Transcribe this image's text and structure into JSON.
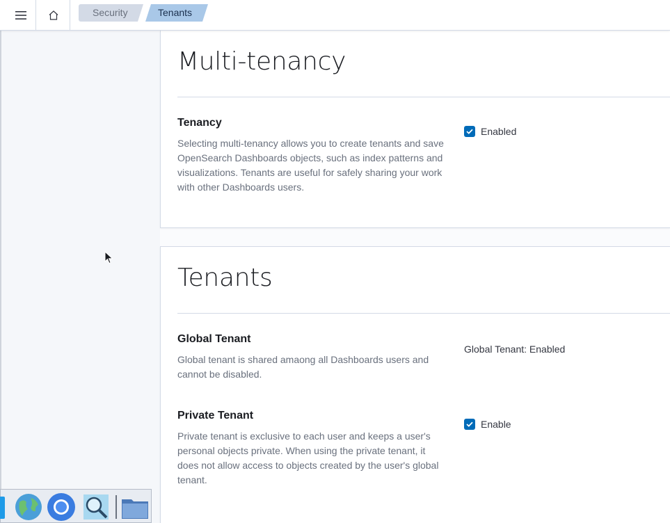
{
  "header": {
    "breadcrumbs": [
      "Security",
      "Tenants"
    ]
  },
  "multitenancy": {
    "title": "Multi-tenancy",
    "tenancy": {
      "label": "Tenancy",
      "description": "Selecting multi-tenancy allows you to create tenants and save OpenSearch Dashboards objects, such as index patterns and visualizations. Tenants are useful for safely sharing your work with other Dashboards users.",
      "checkbox_label": "Enabled",
      "checked": true
    }
  },
  "tenants": {
    "title": "Tenants",
    "global": {
      "label": "Global Tenant",
      "description": "Global tenant is shared amaong all Dashboards users and cannot be disabled.",
      "status": "Global Tenant: Enabled"
    },
    "private": {
      "label": "Private Tenant",
      "description": "Private tenant is exclusive to each user and keeps a user's personal objects private. When using the private tenant, it does not allow access to objects created by the user's global tenant.",
      "checkbox_label": "Enable",
      "checked": true
    }
  },
  "taskbar": {
    "icons": [
      "start-icon",
      "globe-icon",
      "chromium-icon",
      "search-icon",
      "folder-icon"
    ]
  },
  "colors": {
    "accent": "#006bb8",
    "active_crumb": "#a9c8e8"
  }
}
